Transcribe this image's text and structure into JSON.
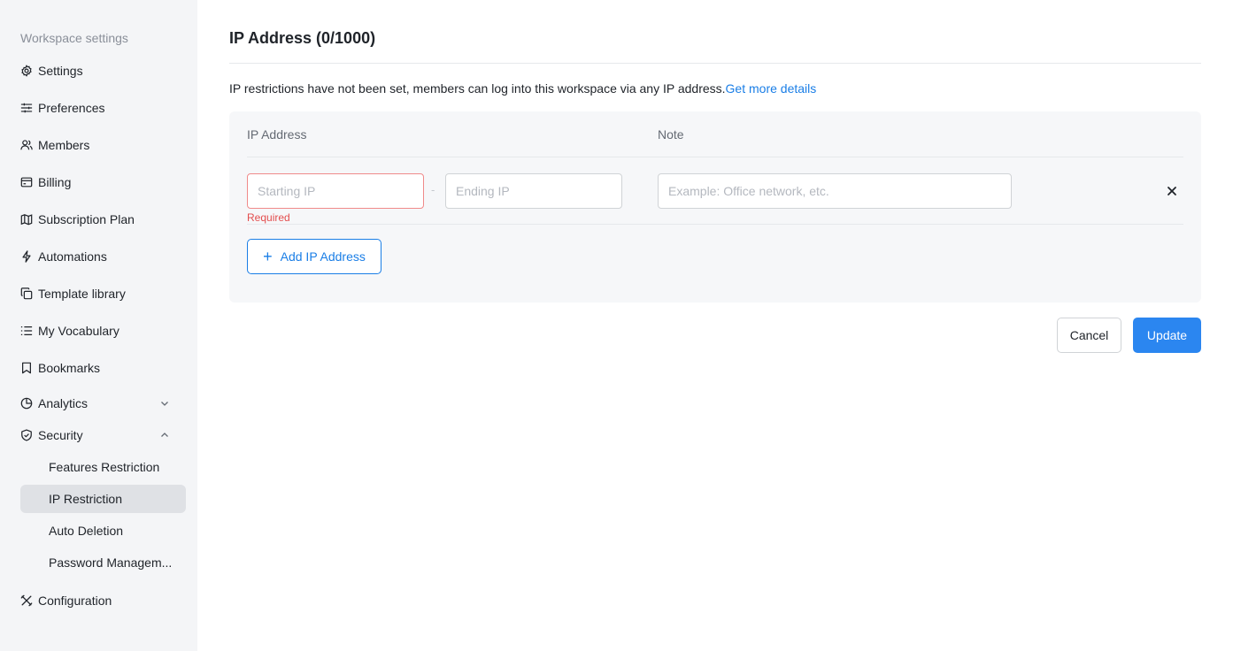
{
  "sidebar": {
    "title": "Workspace settings",
    "items": [
      {
        "label": "Settings",
        "icon": "gear-icon"
      },
      {
        "label": "Preferences",
        "icon": "sliders-icon"
      },
      {
        "label": "Members",
        "icon": "members-icon"
      },
      {
        "label": "Billing",
        "icon": "billing-icon"
      },
      {
        "label": "Subscription Plan",
        "icon": "map-icon"
      },
      {
        "label": "Automations",
        "icon": "lightning-icon"
      },
      {
        "label": "Template library",
        "icon": "template-icon"
      },
      {
        "label": "My Vocabulary",
        "icon": "list-icon"
      },
      {
        "label": "Bookmarks",
        "icon": "bookmark-icon"
      }
    ],
    "analytics": {
      "label": "Analytics",
      "icon": "pie-chart-icon",
      "expanded": false
    },
    "security": {
      "label": "Security",
      "icon": "shield-icon",
      "expanded": true,
      "children": [
        {
          "label": "Features Restriction",
          "active": false
        },
        {
          "label": "IP Restriction",
          "active": true
        },
        {
          "label": "Auto Deletion",
          "active": false
        },
        {
          "label": "Password Managem...",
          "active": false
        }
      ]
    },
    "configuration": {
      "label": "Configuration",
      "icon": "tools-icon"
    }
  },
  "main": {
    "title": "IP Address (0/1000)",
    "description": "IP restrictions have not been set, members can log into this workspace via any IP address.",
    "details_link": "Get more details",
    "table": {
      "col_ip": "IP Address",
      "col_note": "Note",
      "row": {
        "start_placeholder": "Starting IP",
        "start_value": "",
        "dash": "-",
        "end_placeholder": "Ending IP",
        "end_value": "",
        "note_placeholder": "Example: Office network, etc.",
        "note_value": "",
        "error": "Required"
      }
    },
    "add_button": "Add IP Address",
    "cancel_button": "Cancel",
    "update_button": "Update"
  },
  "colors": {
    "accent": "#2b86f0",
    "link": "#1a7ee6",
    "error": "#e34d4d",
    "sidebar_bg": "#f4f5f7",
    "active_bg": "#dfe1e5"
  }
}
